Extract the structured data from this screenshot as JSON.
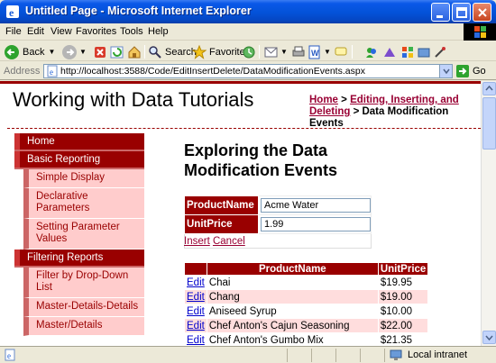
{
  "window": {
    "title": "Untitled Page - Microsoft Internet Explorer"
  },
  "menu": [
    "File",
    "Edit",
    "View",
    "Favorites",
    "Tools",
    "Help"
  ],
  "toolbar": {
    "back_label": "Back",
    "search_label": "Search",
    "favorites_label": "Favorites"
  },
  "address": {
    "label": "Address",
    "url": "http://localhost:3588/Code/EditInsertDelete/DataModificationEvents.aspx",
    "go_label": "Go"
  },
  "page": {
    "site_title": "Working with Data Tutorials",
    "breadcrumb": {
      "home": "Home",
      "sep1": " > ",
      "section": "Editing, Inserting, and Deleting",
      "sep2": " > ",
      "current": "Data Modification Events"
    },
    "heading": "Exploring the Data Modification Events",
    "nav": [
      {
        "label": "Home",
        "level": "top"
      },
      {
        "label": "Basic Reporting",
        "level": "top"
      },
      {
        "label": "Simple Display",
        "level": "sub"
      },
      {
        "label": "Declarative Parameters",
        "level": "sub"
      },
      {
        "label": "Setting Parameter Values",
        "level": "sub"
      },
      {
        "label": "Filtering Reports",
        "level": "top"
      },
      {
        "label": "Filter by Drop-Down List",
        "level": "sub"
      },
      {
        "label": "Master-Details-Details",
        "level": "sub"
      },
      {
        "label": "Master/Details",
        "level": "sub"
      }
    ],
    "form": {
      "product_name_label": "ProductName",
      "product_name_value": "Acme Water",
      "unit_price_label": "UnitPrice",
      "unit_price_value": "1.99",
      "insert_label": "Insert",
      "cancel_label": "Cancel"
    },
    "grid": {
      "headers": [
        "ProductName",
        "UnitPrice"
      ],
      "edit_label": "Edit",
      "rows": [
        {
          "name": "Chai",
          "price": "$19.95"
        },
        {
          "name": "Chang",
          "price": "$19.00"
        },
        {
          "name": "Aniseed Syrup",
          "price": "$10.00"
        },
        {
          "name": "Chef Anton's Cajun Seasoning",
          "price": "$22.00"
        },
        {
          "name": "Chef Anton's Gumbo Mix",
          "price": "$21.35"
        }
      ]
    }
  },
  "status": {
    "zone": "Local intranet"
  },
  "colors": {
    "accent": "#990000",
    "link": "#990033",
    "nav_sub_bg": "#ffcccc",
    "alt_row": "#ffdddd"
  }
}
